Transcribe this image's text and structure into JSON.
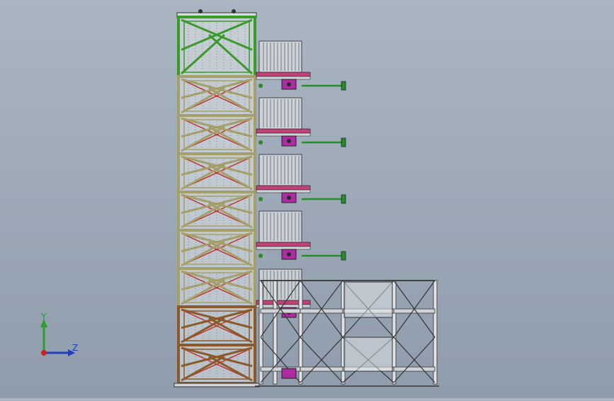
{
  "viewport": {
    "background_top": "#aab5c2",
    "background_bottom": "#8f9cab"
  },
  "colors": {
    "tower_green": "#3a9a2a",
    "tower_khaki": "#a5a06a",
    "tower_brown": "#8a5a2a",
    "brace_red": "#c03030",
    "rack_gray": "#d8dde2",
    "platform_pink": "#c0407a",
    "motor_magenta": "#b02aa0",
    "arm_green": "#2a8a2a"
  },
  "triad": {
    "y_label": "Y",
    "z_label": "Z",
    "icon": "coordinate-triad-icon"
  }
}
